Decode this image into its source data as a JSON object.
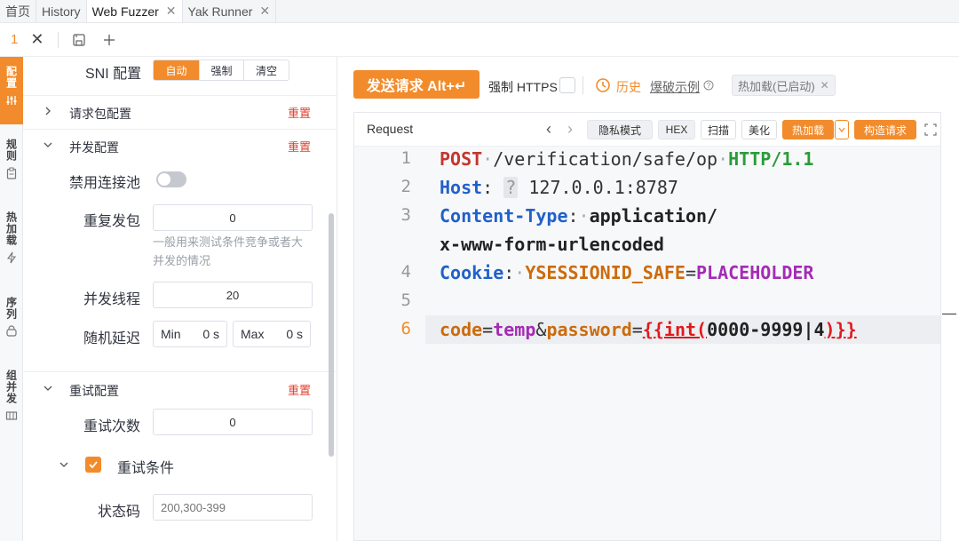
{
  "tabs": [
    {
      "label": "首页"
    },
    {
      "label": "History"
    },
    {
      "label": "Web Fuzzer",
      "closable": true,
      "active": true
    },
    {
      "label": "Yak Runner",
      "closable": true
    }
  ],
  "subtabs": {
    "current": "1"
  },
  "side_tabs": [
    {
      "label": "配置",
      "active": true
    },
    {
      "label": "规则"
    },
    {
      "label": "热加载"
    },
    {
      "label": "序列"
    },
    {
      "label": "组并发"
    }
  ],
  "config": {
    "sni": {
      "label": "SNI 配置",
      "options": [
        "自动",
        "强制",
        "清空"
      ],
      "selected": "自动"
    },
    "request_pkg": {
      "title": "请求包配置",
      "reset": "重置"
    },
    "concurrency": {
      "title": "并发配置",
      "reset": "重置",
      "disable_pool": {
        "label": "禁用连接池",
        "on": false
      },
      "repeat": {
        "label": "重复发包",
        "value": "0",
        "hint": "一般用来测试条件竞争或者大并发的情况"
      },
      "threads": {
        "label": "并发线程",
        "value": "20"
      },
      "delay": {
        "label": "随机延迟",
        "min_label": "Min",
        "min_value": "0 s",
        "max_label": "Max",
        "max_value": "0 s"
      }
    },
    "retry": {
      "title": "重试配置",
      "reset": "重置",
      "times": {
        "label": "重试次数",
        "value": "0"
      },
      "condition": {
        "label": "重试条件",
        "checked": true
      },
      "status_code": {
        "label": "状态码",
        "placeholder": "200,300-399"
      }
    }
  },
  "toolbar": {
    "send": "发送请求 Alt+↵",
    "force_https": "强制 HTTPS",
    "history": "历史",
    "example": "爆破示例",
    "hotload_tag": "热加载(已启动)"
  },
  "editor": {
    "title": "Request",
    "buttons": {
      "privacy": "隐私模式",
      "hex": "HEX",
      "scan": "扫描",
      "beautify": "美化",
      "hotload": "热加载",
      "construct": "构造请求"
    },
    "lines": [
      {
        "n": "1",
        "method": "POST",
        "path": "/verification/safe/op",
        "proto": "HTTP/1.1"
      },
      {
        "n": "2",
        "key": "Host",
        "val": "127.0.0.1:8787"
      },
      {
        "n": "3",
        "key": "Content-Type",
        "val1": "application/",
        "val2": "x-www-form-urlencoded"
      },
      {
        "n": "4",
        "key": "Cookie",
        "ckey": "YSESSIONID_SAFE",
        "cval": "PLACEHOLDER"
      },
      {
        "n": "5"
      },
      {
        "n": "6",
        "p1k": "code",
        "p1v": "temp",
        "p2k": "password",
        "tpl_open": "{{",
        "tpl_fn": "int(",
        "tpl_arg": "0000-9999|4",
        "tpl_close": ")}}"
      }
    ]
  },
  "colors": {
    "accent": "#f28b2b",
    "reset": "#e0412f"
  }
}
